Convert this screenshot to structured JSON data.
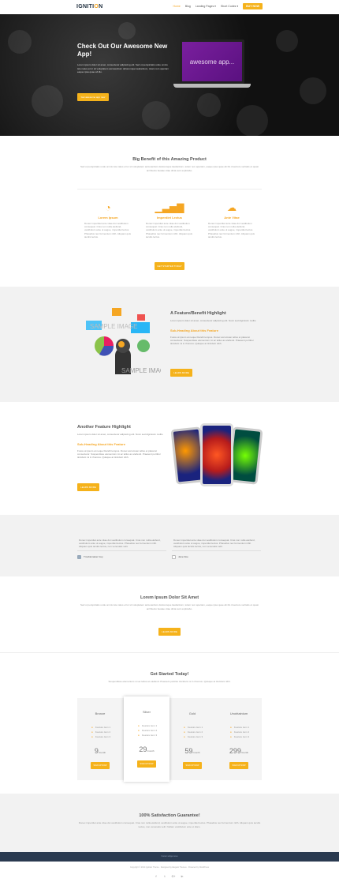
{
  "header": {
    "logo_main": "IGNITI",
    "logo_accent": "O",
    "logo_end": "N",
    "nav": [
      "Home",
      "Blog",
      "Landing Pages ▾",
      "Short Codes ▾"
    ],
    "buy_label": "BUY NOW"
  },
  "hero": {
    "title": "Check Out Our Awesome New App!",
    "text": "Lorem ipsum dolor sit amet, consectetur adipiscing elit. Sed ut perspiciatis unde omnis iste natus error sit voluptatem accusantium doloremque laudantium, totam rem aperiam eaque ipsa quae ab illo.",
    "button": "Get awesome app now",
    "screen_text": "awesome app..."
  },
  "benefits": {
    "title": "Big Benefit of this Amazing Product",
    "subtitle": "Sed ut perspiciatis unde omnis iste natus error sit voluptatem accusantium doloremque laudantium, totam rem aperiam, eaque ipsa quae ab illo inventore veritatis et quasi architecto beatae vitae dicta sunt explicabo.",
    "items": [
      {
        "icon": "dashboard-icon",
        "title": "Lorem Ipsum",
        "text": "Donec imperdiet ante vitae dui vestibulum consequat. Cras non nulla eleifend, vestibulum ante ut augue, imperdiet lectus. Phasellus nec fermentum nibh. Aliquam quis iaculis lectus."
      },
      {
        "icon": "signal-icon",
        "title": "Imperdiet Lectus",
        "text": "Donec imperdiet ante vitae dui vestibulum consequat. Cras non nulla eleifend, vestibulum ante ut augue, imperdiet lectus. Phasellus nec fermentum nibh. Aliquam quis iaculis lectus."
      },
      {
        "icon": "cloud-download-icon",
        "title": "Ante Vitae",
        "text": "Donec imperdiet ante vitae dui vestibulum consequat. Cras non nulla eleifend, vestibulum ante ut augue, imperdiet lectus. Phasellus nec fermentum nibh. Aliquam quis iaculis lectus."
      }
    ],
    "button": "GET STARTED TODAY"
  },
  "feature1": {
    "title": "A Feature/Benefit Highlight",
    "lead": "Lorem ipsum dolor sit amet, consectetur adipiscing elit. Nunc sed dignissim mollis.",
    "subheading": "Sub-Heading About this Feature",
    "text": "Fusce at ipsum at neque blandit tempus. Donec accumsan tellus et placerat consectetur. Suspendisse elementum mi ac tellus ac eleifend. Praesent porttitor tincidunt mi in rhoncus. Quisque at tincidunt nibh.",
    "button": "LEARN MORE",
    "image_label": "SAMPLE IMAGE"
  },
  "feature2": {
    "title": "Another Feature Highlight",
    "lead": "Lorem ipsum dolor sit amet, consectetur adipiscing elit. Nunc sed dignissim mollis.",
    "subheading": "Sub-Heading About this Feature",
    "text": "Fusce at ipsum at neque blandit tempus. Donec accumsan tellus et placerat consectetur. Suspendisse elementum mi ac tellus ac eleifend. Praesent porttitor tincidunt mi in rhoncus. Quisque at tincidunt nibh.",
    "button": "LEARN MORE"
  },
  "testimonials": [
    {
      "text": "Donec imperdiet ante vitae dui vestibulum consequat. Cras non nulla eleifend, vestibulum ante ut augue, imperdiet lectus. Phasellus nec fermentum nibh. Aliquam quis iaculis lectus, non venenatis velit.",
      "author": "Troublemaker Guy"
    },
    {
      "text": "Donec imperdiet ante vitae dui vestibulum consequat. Cras non nulla eleifend, vestibulum ante ut augue, imperdiet lectus. Phasellus nec fermentum nibh. Aliquam quis iaculis lectus, non venenatis velit.",
      "author": "Jane Doe"
    }
  ],
  "cta": {
    "title": "Lorem Ipsum Dolor Sit Amet",
    "text": "Sed ut perspiciatis unde omnis iste natus error sit voluptatem accusantium doloremque laudantium, totam rem aperiam, eaque ipsa quae ab illo inventore veritatis et quasi architecto beatae vitae dicta sunt explicabo.",
    "button": "LEARN MORE"
  },
  "pricing": {
    "title": "Get Started Today!",
    "subtitle": "Suspendisse elementum mi ac tellus ac eleifend. Praesent porttitor tincidunt mi in rhoncus. Quisque at tincidunt nibh.",
    "plans": [
      {
        "name": "Bronze",
        "features": [
          "Feature item 1",
          "Feature item 2",
          "Feature item 3"
        ],
        "price": "9",
        "period": "/month",
        "button": "SIGN UP NOW"
      },
      {
        "name": "Silver",
        "features": [
          "Feature item 1",
          "Feature item 2",
          "Feature item 3"
        ],
        "price": "29",
        "period": "/month",
        "button": "SIGN UP NOW"
      },
      {
        "name": "Gold",
        "features": [
          "Feature item 1",
          "Feature item 2",
          "Feature item 3"
        ],
        "price": "59",
        "period": "/month",
        "button": "SIGN UP NOW"
      },
      {
        "name": "Unobtainium",
        "features": [
          "Feature item 1",
          "Feature item 2",
          "Feature item 3"
        ],
        "price": "299",
        "period": "/month",
        "button": "SIGN UP NOW"
      }
    ]
  },
  "guarantee": {
    "title": "100% Satisfaction Guarantee!",
    "text": "Donec imperdiet ante vitae dui vestibulum consequat. Cras non nulla eleifend, vestibulum ante ut augue, imperdiet lectus. Phasellus nec fermentum nibh. Aliquam quis iaculis lectus, non venenatis velit. Nullam vestibulum ante ut diam."
  },
  "footer": {
    "bar": "Footer widget area",
    "copyright": "Copyright © 2014 Ignition Theme · Designed by Elegant Themes · Powered by WordPress",
    "social": [
      "f",
      "t",
      "G+",
      "in"
    ]
  }
}
